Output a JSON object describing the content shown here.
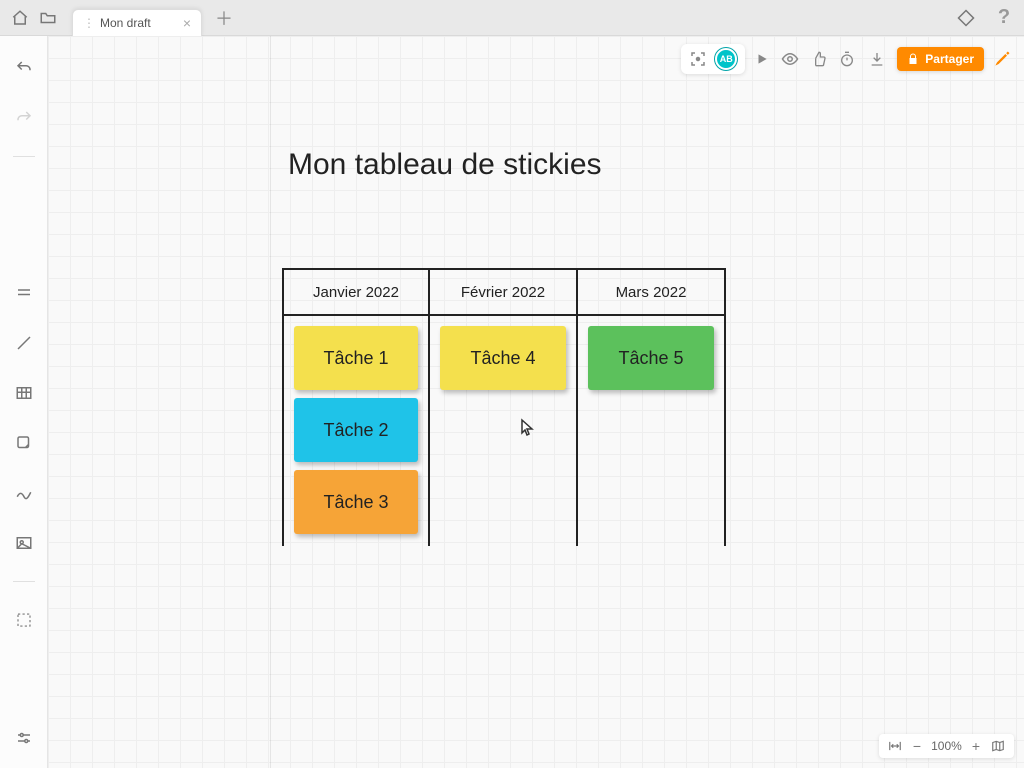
{
  "header": {
    "tab_label": "Mon draft"
  },
  "avatar": {
    "initials": "AB"
  },
  "share": {
    "label": "Partager"
  },
  "board": {
    "title": "Mon tableau de stickies",
    "columns": [
      {
        "header": "Janvier 2022",
        "cards": [
          {
            "label": "Tâche 1",
            "color": "yellow"
          },
          {
            "label": "Tâche 2",
            "color": "cyan"
          },
          {
            "label": "Tâche 3",
            "color": "orange"
          }
        ]
      },
      {
        "header": "Février 2022",
        "cards": [
          {
            "label": "Tâche 4",
            "color": "yellow"
          }
        ]
      },
      {
        "header": "Mars 2022",
        "cards": [
          {
            "label": "Tâche 5",
            "color": "green"
          }
        ]
      }
    ]
  },
  "zoom": {
    "level": "100%"
  }
}
